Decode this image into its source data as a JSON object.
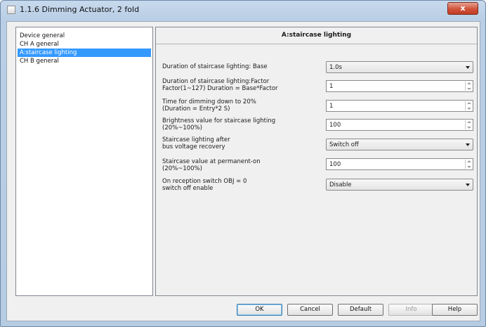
{
  "window": {
    "title": "1.1.6 Dimming Actuator, 2 fold",
    "close_label": "x"
  },
  "tree": {
    "items": [
      {
        "label": "Device general",
        "selected": false
      },
      {
        "label": "CH A general",
        "selected": false
      },
      {
        "label": "A:staircase lighting",
        "selected": true
      },
      {
        "label": "CH B general",
        "selected": false
      }
    ]
  },
  "panel": {
    "title": "A:staircase lighting",
    "params": [
      {
        "label_lines": [
          "Duration of staircase lighting: Base"
        ],
        "control": "dropdown",
        "value": "1.0s"
      },
      {
        "label_lines": [
          "Duration of staircase lighting:Factor",
          "Factor(1~127)  Duration = Base*Factor"
        ],
        "control": "spin",
        "value": "1"
      },
      {
        "label_lines": [
          "Time for dimming down to 20%",
          "(Duration = Entry*2 S)"
        ],
        "control": "spin",
        "value": "1"
      },
      {
        "label_lines": [
          "Brightness value for staircase lighting",
          "(20%~100%)"
        ],
        "control": "spin",
        "value": "100"
      },
      {
        "label_lines": [
          "Staircase lighting after",
          "bus voltage recovery"
        ],
        "control": "dropdown",
        "value": "Switch off"
      },
      {
        "label_lines": [
          "Staircase value at permanent-on",
          "(20%~100%)"
        ],
        "control": "spin",
        "value": "100"
      },
      {
        "label_lines": [
          "On reception switch OBJ = 0",
          "switch off enable"
        ],
        "control": "dropdown",
        "value": "Disable"
      }
    ]
  },
  "buttons": {
    "ok": "OK",
    "cancel": "Cancel",
    "default": "Default",
    "info": "Info",
    "help": "Help"
  }
}
